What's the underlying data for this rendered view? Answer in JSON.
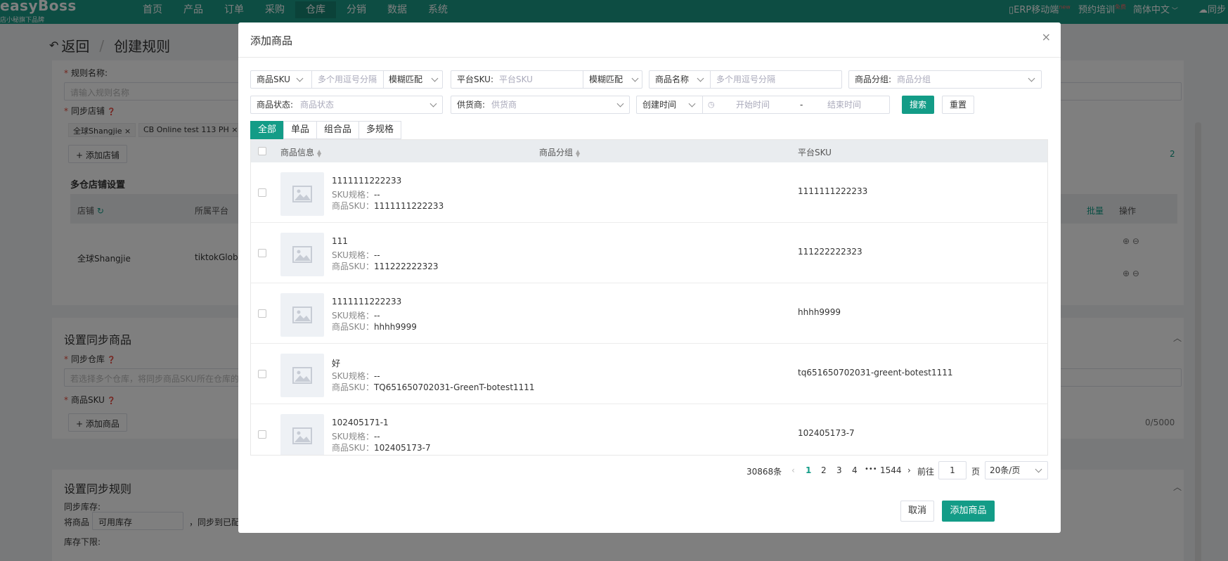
{
  "topnav": {
    "logo": "easyBoss",
    "logo_sub": "店小秘旗下品牌",
    "items": [
      "首页",
      "产品",
      "订单",
      "采购",
      "仓库",
      "分销",
      "数据",
      "系统"
    ],
    "active": "仓库",
    "right": {
      "erp": "ERP移动端",
      "erp_badge": "new",
      "training": "预约培训",
      "training_badge": "免费",
      "lang": "简体中文",
      "sync": "同步"
    }
  },
  "page": {
    "back": "返回",
    "title": "创建规则",
    "rule_name_label": "规则名称:",
    "rule_name_placeholder": "请输入规则名称",
    "sync_store_label": "同步店铺",
    "store_tags": [
      "全球Shangjie",
      "CB Online test 113 PH"
    ],
    "add_store": "添加店铺",
    "store_count": "2",
    "multi_wh_title": "多仓店铺设置",
    "col_store": "店铺",
    "col_platform": "所属平台",
    "col_batch": "批量",
    "col_action": "操作",
    "row_store": "全球Shangjie",
    "row_platform": "tiktokGlobal",
    "sync_goods_title": "设置同步商品",
    "sync_wh_label": "同步仓库",
    "sync_wh_placeholder": "若选择多个仓库，将同步商品SKU所在仓库的",
    "sku_label": "商品SKU",
    "add_goods": "添加商品",
    "sku_count": "0/5000",
    "sync_rule_title": "设置同步规则",
    "sync_stock_label": "同步库存:",
    "stock_prefix": "将商品",
    "stock_select": "可用库存",
    "stock_suffix": "，同步到已配",
    "stock_lower_label": "库存下限:"
  },
  "modal": {
    "title": "添加商品",
    "close": "×",
    "filters": {
      "sku_type": "商品SKU",
      "sku_placeholder": "多个用逗号分隔",
      "sku_match": "模糊匹配",
      "platform_sku_label": "平台SKU:",
      "platform_sku_placeholder": "平台SKU",
      "platform_match": "模糊匹配",
      "name_type": "商品名称",
      "name_placeholder": "多个用逗号分隔",
      "group_label": "商品分组:",
      "group_placeholder": "商品分组",
      "status_label": "商品状态:",
      "status_placeholder": "商品状态",
      "supplier_label": "供货商:",
      "supplier_placeholder": "供货商",
      "time_type": "创建时间",
      "start_placeholder": "开始时间",
      "dash": "-",
      "end_placeholder": "结束时间",
      "search": "搜索",
      "reset": "重置"
    },
    "tabs": [
      "全部",
      "单品",
      "组合品",
      "多规格"
    ],
    "columns": {
      "info": "商品信息",
      "group": "商品分组",
      "platform_sku": "平台SKU"
    },
    "spec_key": "SKU规格：",
    "sku_key": "商品SKU：",
    "rows": [
      {
        "name": "1111111222233",
        "spec": "--",
        "sku": "1111111222233",
        "platform_sku": "1111111222233"
      },
      {
        "name": "111",
        "spec": "--",
        "sku": "111222222323",
        "platform_sku": "111222222323"
      },
      {
        "name": "1111111222233",
        "spec": "--",
        "sku": "hhhh9999",
        "platform_sku": "hhhh9999"
      },
      {
        "name": "好",
        "spec": "--",
        "sku": "TQ651650702031-GreenT-botest1111",
        "platform_sku": "tq651650702031-greent-botest1111"
      },
      {
        "name": "102405171-1",
        "spec": "--",
        "sku": "102405173-7",
        "platform_sku": "102405173-7"
      }
    ],
    "pagination": {
      "total": "30868条",
      "pages": [
        "1",
        "2",
        "3",
        "4"
      ],
      "ellipsis": "•••",
      "last": "1544",
      "goto": "前往",
      "page_value": "1",
      "page_unit": "页",
      "page_size": "20条/页"
    },
    "cancel": "取消",
    "confirm": "添加商品"
  }
}
